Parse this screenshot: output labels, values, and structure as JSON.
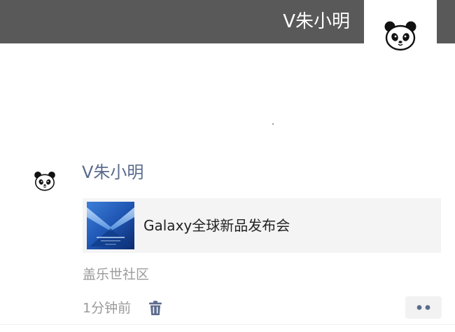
{
  "cover": {
    "name": "V朱小明",
    "background_color": "#595959"
  },
  "profile": {
    "avatar_icon": "panda-icon"
  },
  "post": {
    "avatar_icon": "panda-icon",
    "author": "V朱小明",
    "link": {
      "thumbnail_icon": "event-poster-thumbnail",
      "title": "Galaxy全球新品发布会"
    },
    "source": "盖乐世社区",
    "time": "1分钟前",
    "delete_icon": "trash-icon",
    "more_icon": "more-dots-icon"
  },
  "colors": {
    "author_name": "#5b6b8c",
    "meta_text": "#9a9a9a"
  }
}
